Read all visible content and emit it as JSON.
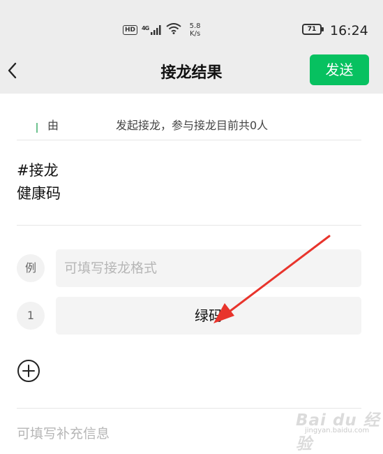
{
  "status_bar": {
    "hd": "HD",
    "network": "4G",
    "speed_value": "5.8",
    "speed_unit": "K/s",
    "battery": "71",
    "time": "16:24"
  },
  "header": {
    "title": "接龙结果",
    "send_label": "发送"
  },
  "info": {
    "by_label": "由",
    "started_text": "发起接龙，参与接龙目前共0人"
  },
  "topic": {
    "hashtag": "#接龙",
    "subject": "健康码"
  },
  "rows": [
    {
      "badge": "例",
      "placeholder": "可填写接龙格式",
      "value": ""
    },
    {
      "badge": "1",
      "placeholder": "",
      "value": "绿码"
    }
  ],
  "supplement_placeholder": "可填写补充信息",
  "watermark": {
    "logo": "Bai du 经验",
    "url": "jingyan.baidu.com"
  },
  "colors": {
    "header_bg": "#ededed",
    "send_green": "#07c160",
    "arrow_red": "#e8342c"
  }
}
